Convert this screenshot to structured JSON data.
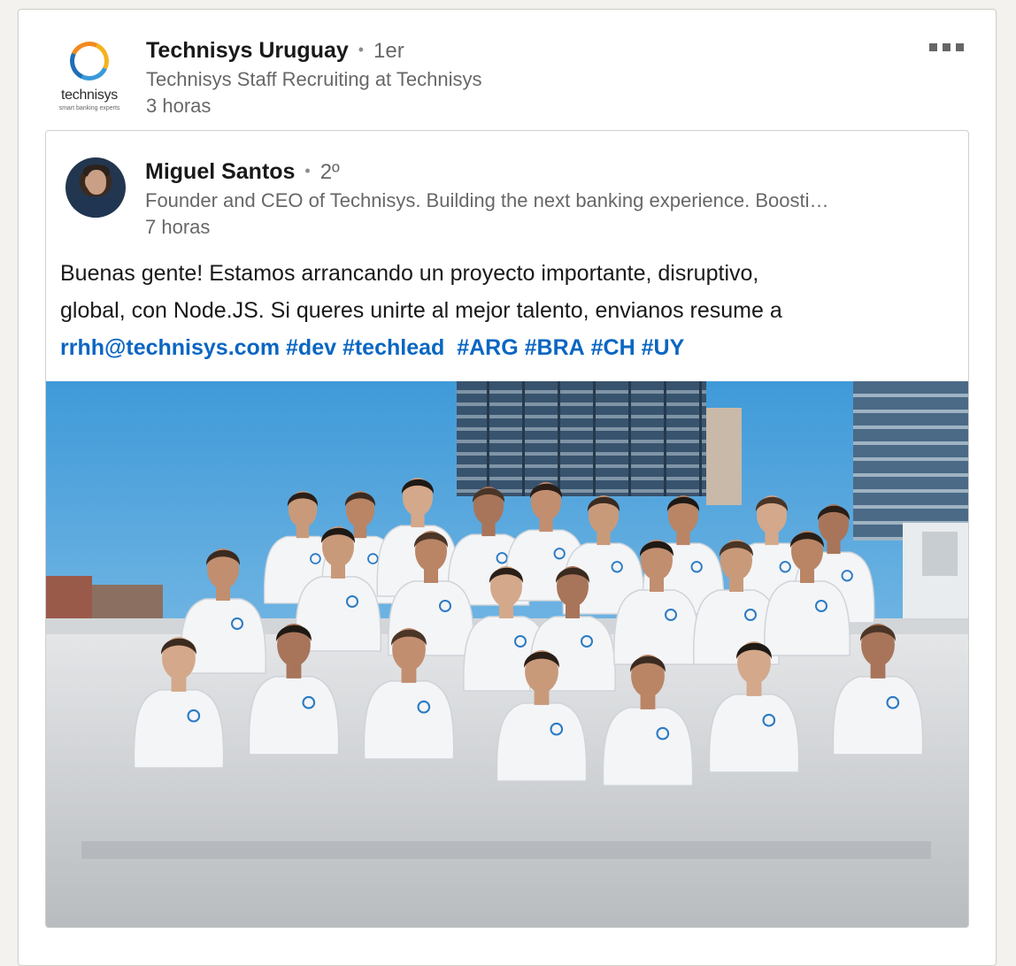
{
  "post": {
    "actor": {
      "name": "Technisys Uruguay",
      "degree": "1er",
      "separator": "•",
      "description": "Technisys Staff Recruiting at Technisys",
      "time": "3 horas",
      "logo_word": "technisys",
      "logo_tagline": "smart banking experts",
      "logo_icon": "technisys-ring-logo"
    },
    "menu_icon": "ellipsis-icon",
    "reshare": {
      "author": {
        "name": "Miguel Santos",
        "degree": "2º",
        "separator": "•",
        "headline": "Founder and CEO of Technisys. Building the next banking experience. Boosti…",
        "time": "7 horas"
      },
      "text_lines": [
        "Buenas gente! Estamos arrancando un proyecto importante, disruptivo,",
        "global, con Node.JS. Si queres unirte al mejor talento, envianos resume a"
      ],
      "email": "rrhh@technisys.com",
      "hashtags": [
        "#dev",
        "#techlead",
        "#ARG",
        "#BRA",
        "#CH",
        "#UY"
      ],
      "image": {
        "description_icon": "team-photo-image",
        "shirt_logo": "technisys"
      }
    }
  },
  "colors": {
    "link": "#0a66c2",
    "text": "#191919",
    "secondary": "#666666",
    "sky": "#4aa3e0",
    "shirt": "#f4f5f7"
  }
}
